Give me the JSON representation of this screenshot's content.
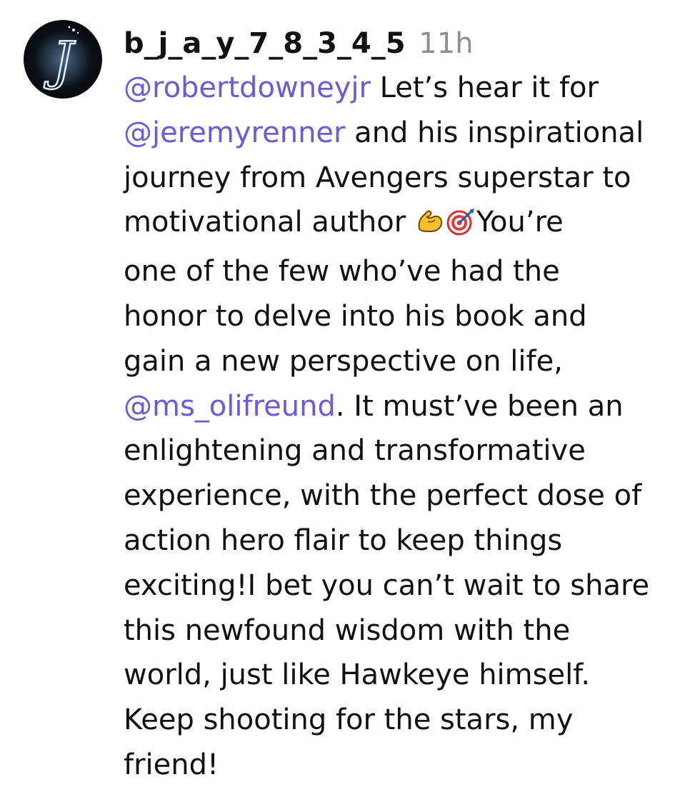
{
  "comment": {
    "username": "b_j_a_y_7_8_3_4_5",
    "timestamp": "11h",
    "avatar_letter": "J",
    "emojis": [
      "flexed-biceps-icon",
      "direct-hit-icon"
    ],
    "mentions": {
      "m1": "@robertdowneyjr",
      "m2": "@jeremyrenner",
      "m3": "@ms_olifreund"
    },
    "text": {
      "l1_after": " Let’s hear it for",
      "l2_after": " and his inspirational",
      "l3": "journey from Avengers superstar to",
      "l4_before": "motivational author ",
      "l4_after": "You’re",
      "l5": "one of the few who’ve had the",
      "l6": "honor to delve into his book and",
      "l7": "gain a new perspective on life,",
      "l8_after": ". It must’ve been an",
      "l9": "enlightening and transformative",
      "l10": "experience, with the perfect dose of",
      "l11": "action hero flair to keep things",
      "l12": "exciting!I bet you can’t wait to share",
      "l13": "this newfound wisdom with the",
      "l14": "world, just like Hawkeye himself.",
      "l15": "Keep shooting for the stars, my",
      "l16": "friend!"
    }
  }
}
